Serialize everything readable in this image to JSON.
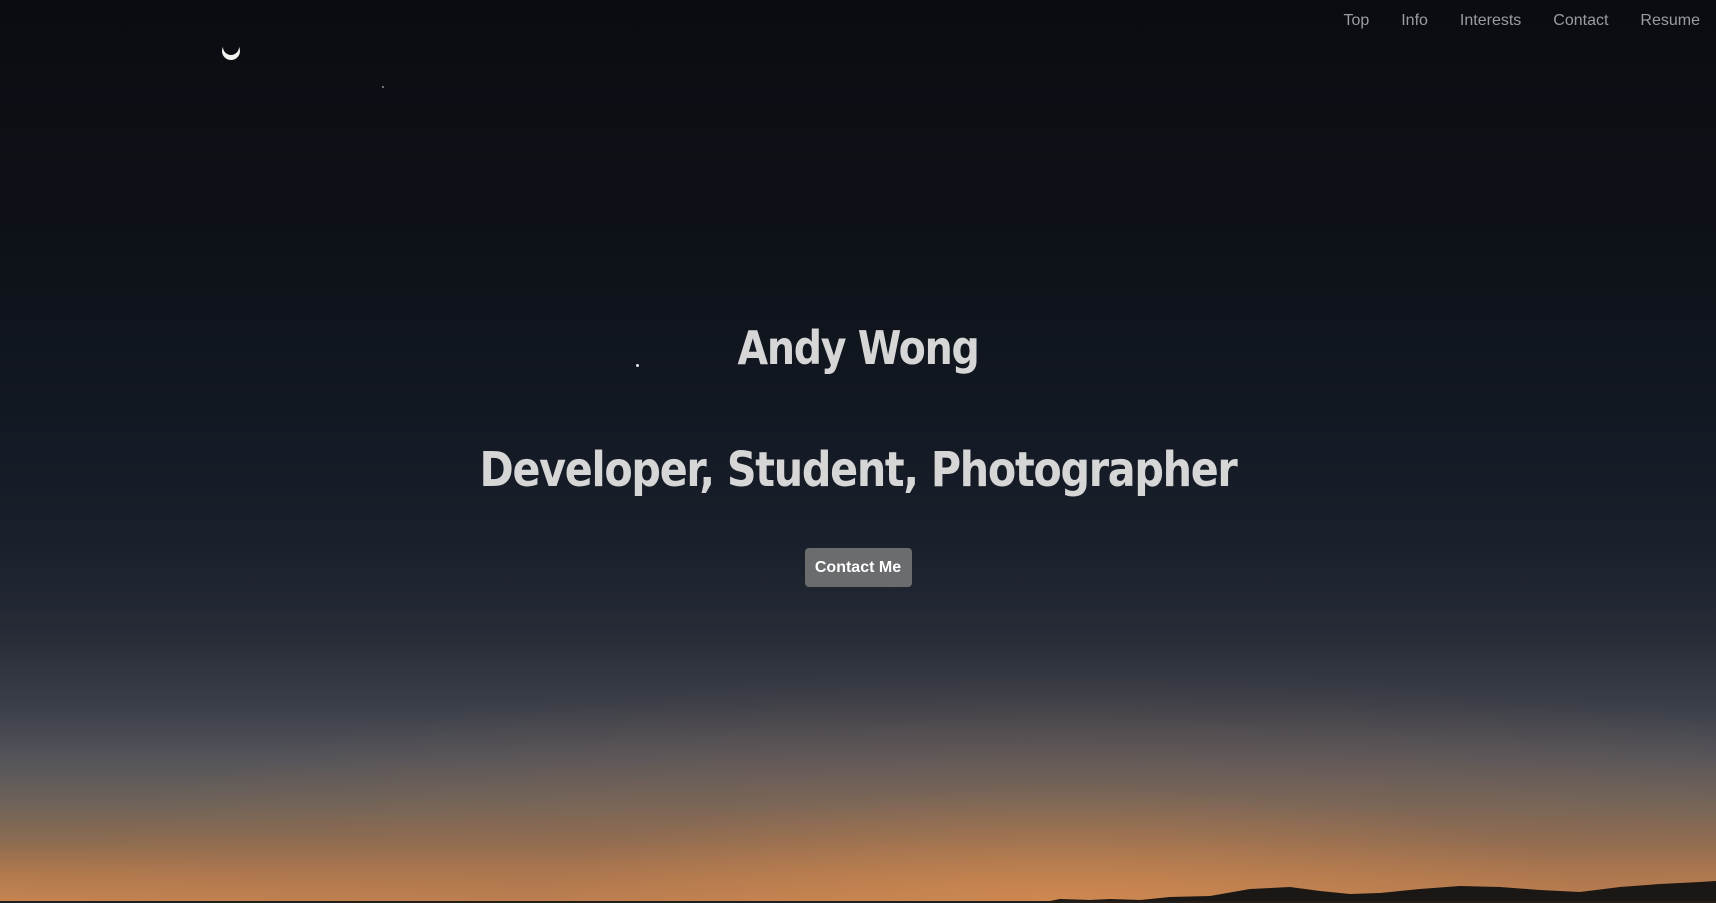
{
  "nav": {
    "items": [
      {
        "label": "Top"
      },
      {
        "label": "Info"
      },
      {
        "label": "Interests"
      },
      {
        "label": "Contact"
      },
      {
        "label": "Resume"
      }
    ]
  },
  "hero": {
    "name": "Andy Wong",
    "tagline": "Developer, Student, Photographer",
    "cta_label": "Contact Me"
  },
  "background": {
    "scene": "night-sky-sunset",
    "icons": [
      "moon-icon",
      "star-icon"
    ]
  },
  "colors": {
    "text": "#d6d6d6",
    "nav_text": "#9a9ca0",
    "button_bg": "#6b6c6e",
    "sky_top": "#0a0c11",
    "horizon": "#c78450"
  }
}
